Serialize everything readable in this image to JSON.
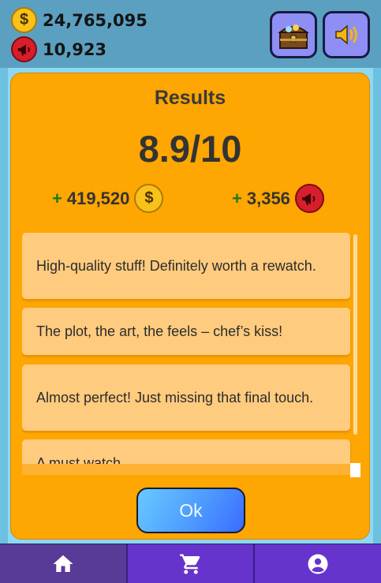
{
  "header": {
    "coins": "24,765,095",
    "tickets": "10,923",
    "coin_icon_glyph": "$",
    "chest_button_icon": "treasure-chest-icon",
    "sound_button_icon": "speaker-icon"
  },
  "results": {
    "title": "Results",
    "score": "8.9/10",
    "coins_reward": {
      "plus": "+",
      "value": "419,520"
    },
    "tickets_reward": {
      "plus": "+",
      "value": "3,356"
    },
    "reviews": [
      "High-quality stuff! Definitely worth a rewatch.",
      "The plot, the art, the feels – chef’s kiss!",
      "Almost perfect! Just missing that final touch.",
      "A must watch."
    ],
    "ok_label": "Ok"
  },
  "nav": {
    "items": [
      {
        "icon": "home-icon",
        "active": true
      },
      {
        "icon": "cart-icon",
        "active": false
      },
      {
        "icon": "account-icon",
        "active": false
      }
    ]
  },
  "colors": {
    "panel": "#fea601",
    "card": "#ffcb7e",
    "nav": "#6633cc",
    "coin": "#f8c21a",
    "ticket": "#d81e2a"
  }
}
